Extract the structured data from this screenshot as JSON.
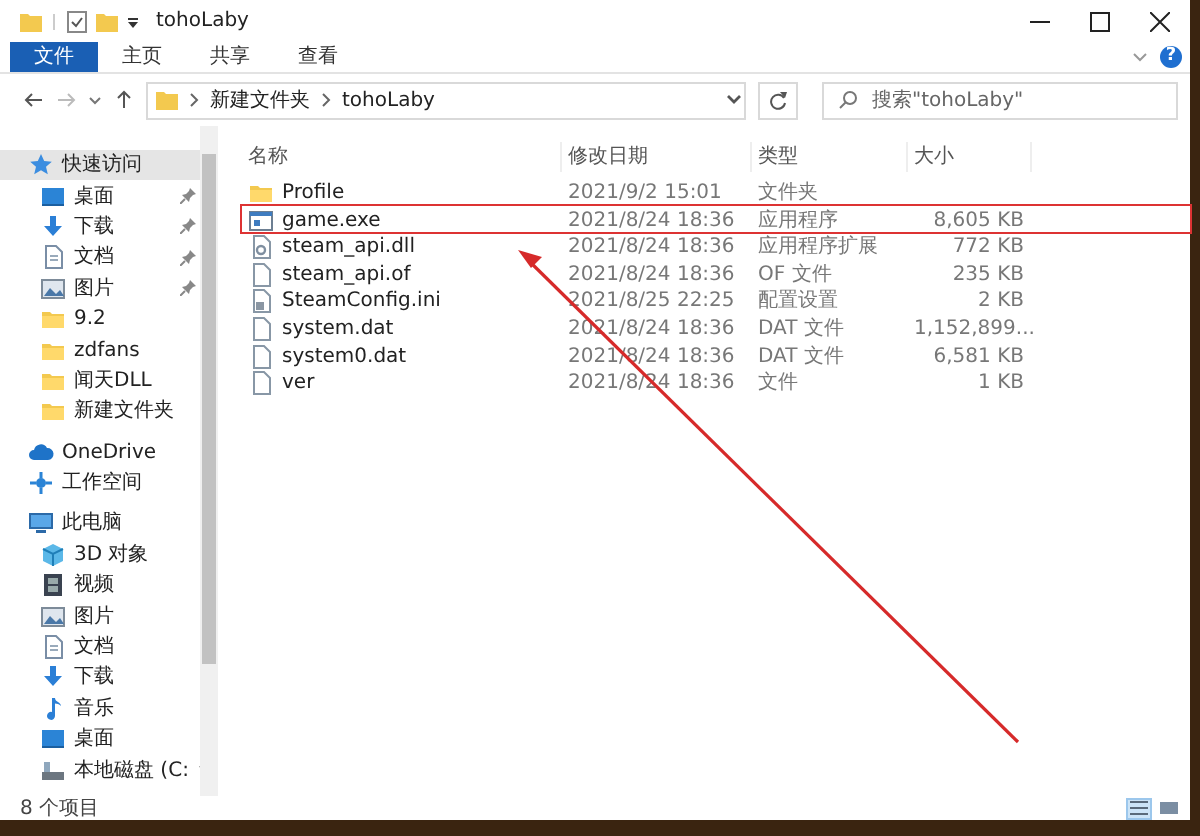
{
  "window": {
    "title": "tohoLaby",
    "help": "?"
  },
  "ribbon_tabs": [
    {
      "label": "文件",
      "selected": true
    },
    {
      "label": "主页",
      "selected": false
    },
    {
      "label": "共享",
      "selected": false
    },
    {
      "label": "查看",
      "selected": false
    }
  ],
  "address": {
    "path": [
      "新建文件夹",
      "tohoLaby"
    ]
  },
  "search": {
    "placeholder": "搜索\"tohoLaby\""
  },
  "sidebar": {
    "items": [
      {
        "label": "快速访问",
        "kind": "star",
        "selected": true,
        "children": [
          {
            "label": "桌面",
            "kind": "desktop",
            "pinned": true
          },
          {
            "label": "下载",
            "kind": "download",
            "pinned": true
          },
          {
            "label": "文档",
            "kind": "document",
            "pinned": true
          },
          {
            "label": "图片",
            "kind": "pictures",
            "pinned": true
          },
          {
            "label": "9.2",
            "kind": "folder",
            "pinned": false
          },
          {
            "label": "zdfans",
            "kind": "folder",
            "pinned": false
          },
          {
            "label": "闻天DLL",
            "kind": "folder",
            "pinned": false
          },
          {
            "label": "新建文件夹",
            "kind": "folder",
            "pinned": false
          }
        ]
      },
      {
        "label": "OneDrive",
        "kind": "cloud",
        "selected": false
      },
      {
        "label": "工作空间",
        "kind": "workspace",
        "selected": false
      },
      {
        "label": "此电脑",
        "kind": "computer",
        "selected": false,
        "children": [
          {
            "label": "3D 对象",
            "kind": "cube"
          },
          {
            "label": "视频",
            "kind": "video"
          },
          {
            "label": "图片",
            "kind": "pictures"
          },
          {
            "label": "文档",
            "kind": "document"
          },
          {
            "label": "下载",
            "kind": "download"
          },
          {
            "label": "音乐",
            "kind": "music"
          },
          {
            "label": "桌面",
            "kind": "desktop"
          },
          {
            "label": "本地磁盘 (C:",
            "kind": "drive",
            "expandable": true
          }
        ]
      }
    ]
  },
  "table": {
    "columns": [
      "名称",
      "修改日期",
      "类型",
      "大小"
    ],
    "rows": [
      {
        "kind": "folder",
        "name": "Profile",
        "date": "2021/9/2 15:01",
        "type": "文件夹",
        "size": "",
        "highlighted": false
      },
      {
        "kind": "exe",
        "name": "game.exe",
        "date": "2021/8/24 18:36",
        "type": "应用程序",
        "size": "8,605 KB",
        "highlighted": true
      },
      {
        "kind": "dll",
        "name": "steam_api.dll",
        "date": "2021/8/24 18:36",
        "type": "应用程序扩展",
        "size": "772 KB",
        "highlighted": false
      },
      {
        "kind": "file",
        "name": "steam_api.of",
        "date": "2021/8/24 18:36",
        "type": "OF 文件",
        "size": "235 KB",
        "highlighted": false
      },
      {
        "kind": "ini",
        "name": "SteamConfig.ini",
        "date": "2021/8/25 22:25",
        "type": "配置设置",
        "size": "2 KB",
        "highlighted": false
      },
      {
        "kind": "file",
        "name": "system.dat",
        "date": "2021/8/24 18:36",
        "type": "DAT 文件",
        "size": "1,152,899...",
        "highlighted": false
      },
      {
        "kind": "file",
        "name": "system0.dat",
        "date": "2021/8/24 18:36",
        "type": "DAT 文件",
        "size": "6,581 KB",
        "highlighted": false
      },
      {
        "kind": "file",
        "name": "ver",
        "date": "2021/8/24 18:36",
        "type": "文件",
        "size": "1 KB",
        "highlighted": false
      }
    ]
  },
  "status_bar": {
    "text": "8 个项目",
    "views": [
      {
        "kind": "details",
        "selected": true
      },
      {
        "kind": "large",
        "selected": false
      }
    ]
  }
}
